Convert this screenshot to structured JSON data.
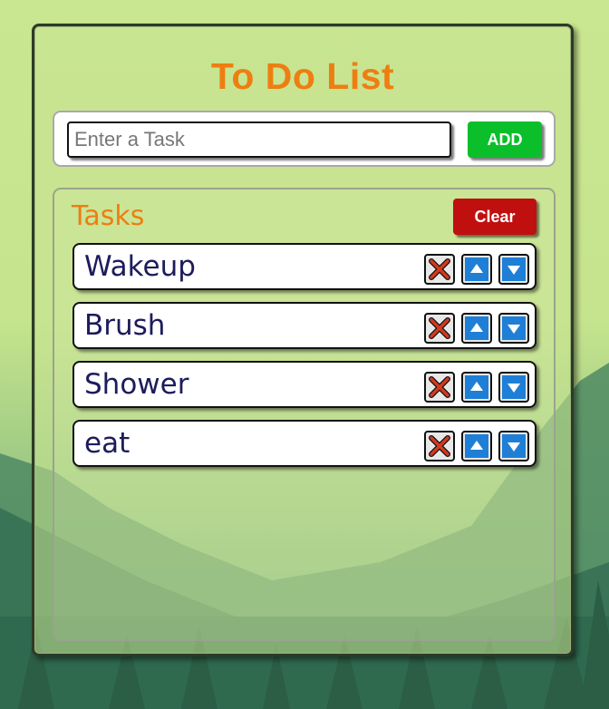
{
  "app": {
    "title": "To Do List"
  },
  "add_form": {
    "placeholder": "Enter a Task",
    "add_label": "ADD"
  },
  "tasks_panel": {
    "heading": "Tasks",
    "clear_label": "Clear",
    "items": [
      {
        "label": "Wakeup"
      },
      {
        "label": "Brush"
      },
      {
        "label": "Shower"
      },
      {
        "label": "eat"
      }
    ]
  },
  "icons": {
    "delete": "close-x-icon",
    "move_up": "arrow-up-icon",
    "move_down": "arrow-down-icon"
  },
  "colors": {
    "title": "#ee7e12",
    "add_button": "#0bbf2a",
    "clear_button": "#c00f0f",
    "task_text": "#1c1c5c",
    "delete_icon": "#d23a1e",
    "arrow_icon": "#1f7fd6"
  }
}
